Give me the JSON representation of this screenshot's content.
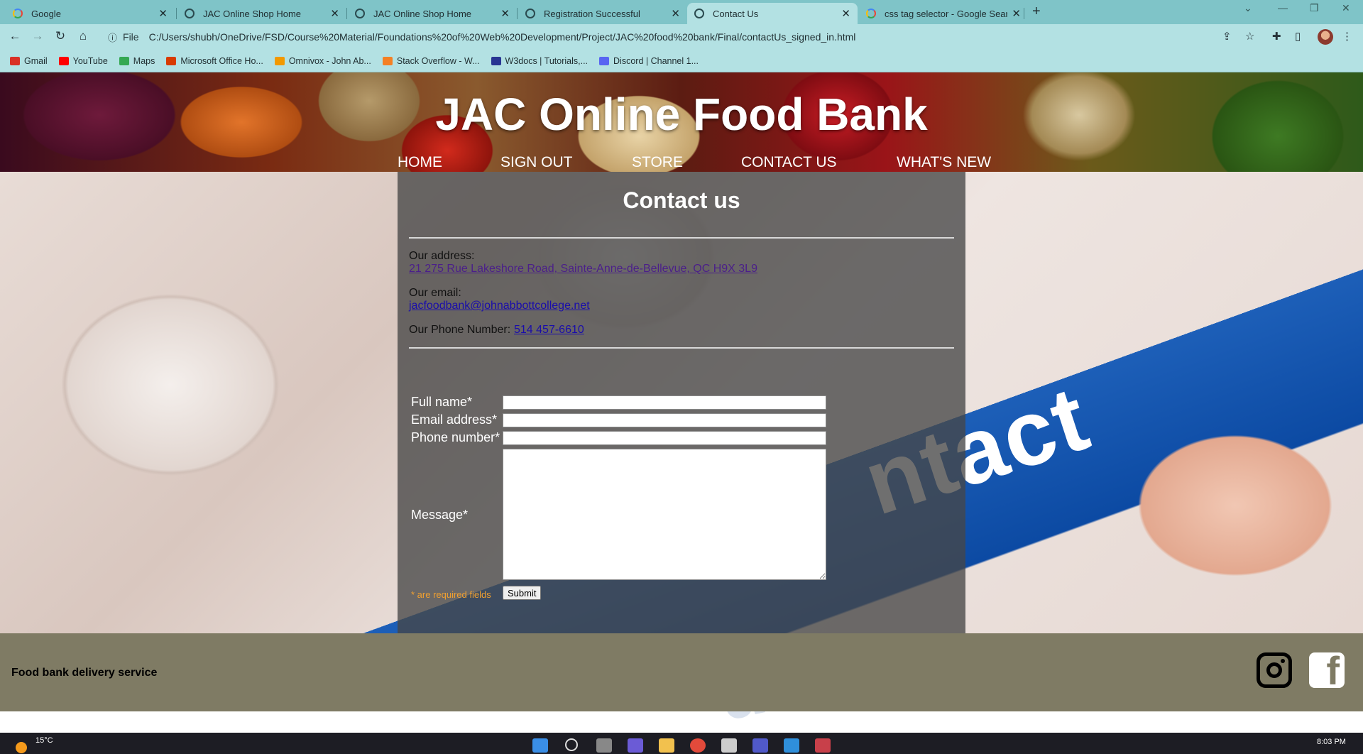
{
  "browser": {
    "tabs": [
      {
        "title": "Google",
        "active": false
      },
      {
        "title": "JAC Online Shop Home",
        "active": false
      },
      {
        "title": "JAC Online Shop Home",
        "active": false
      },
      {
        "title": "Registration Successful",
        "active": false
      },
      {
        "title": "Contact Us",
        "active": true
      },
      {
        "title": "css tag selector - Google Search",
        "active": false
      }
    ],
    "new_tab_label": "+",
    "address_prefix": "File",
    "url": "C:/Users/shubh/OneDrive/FSD/Course%20Material/Foundations%20of%20Web%20Development/Project/JAC%20food%20bank/Final/contactUs_signed_in.html",
    "bookmarks": [
      {
        "label": "Gmail",
        "color": "#d93025"
      },
      {
        "label": "YouTube",
        "color": "#ff0000"
      },
      {
        "label": "Maps",
        "color": "#34a853"
      },
      {
        "label": "Microsoft Office Ho...",
        "color": "#d83b01"
      },
      {
        "label": "Omnivox - John Ab...",
        "color": "#f29900"
      },
      {
        "label": "Stack Overflow - W...",
        "color": "#f48024"
      },
      {
        "label": "W3docs | Tutorials,...",
        "color": "#283593"
      },
      {
        "label": "Discord | Channel 1...",
        "color": "#5865f2"
      }
    ]
  },
  "site": {
    "title": "JAC Online Food Bank",
    "nav": [
      "HOME",
      "SIGN OUT",
      "STORE",
      "CONTACT US",
      "WHAT'S NEW"
    ],
    "contact": {
      "heading": "Contact us",
      "address_label": "Our address:",
      "address": "21 275 Rue Lakeshore Road, Sainte-Anne-de-Bellevue, QC H9X 3L9",
      "email_label": "Our email:",
      "email": "jacfoodbank@johnabbottcollege.net",
      "phone_label": "Our Phone Number:",
      "phone": "514 457-6610"
    },
    "form": {
      "full_name_label": "Full name*",
      "email_label": "Email address*",
      "phone_label": "Phone number*",
      "message_label": "Message*",
      "required_note": "* are required fields",
      "submit_label": "Submit"
    },
    "footer": {
      "text": "Food bank delivery service"
    }
  },
  "taskbar": {
    "temperature": "15°C",
    "time": "8:03 PM"
  }
}
